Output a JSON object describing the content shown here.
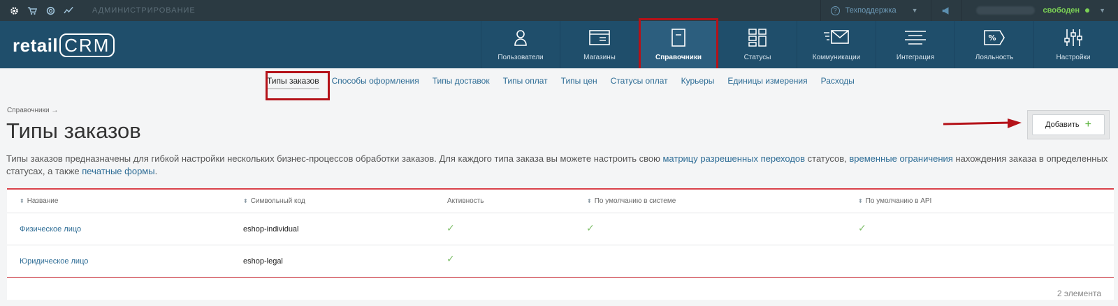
{
  "topbar": {
    "admin_label": "АДМИНИСТРИРОВАНИЕ",
    "support_label": "Техподдержка",
    "status_label": "свободен"
  },
  "header": {
    "logo_text": "retail",
    "logo_crm": "CRM",
    "nav": [
      {
        "label": "Пользователи",
        "icon": "user-icon"
      },
      {
        "label": "Магазины",
        "icon": "store-icon"
      },
      {
        "label": "Справочники",
        "icon": "reference-book-icon"
      },
      {
        "label": "Статусы",
        "icon": "statuses-icon"
      },
      {
        "label": "Коммуникации",
        "icon": "communications-icon"
      },
      {
        "label": "Интеграция",
        "icon": "integration-icon"
      },
      {
        "label": "Лояльность",
        "icon": "loyalty-icon"
      },
      {
        "label": "Настройки",
        "icon": "settings-sliders-icon"
      }
    ]
  },
  "subnav": [
    "Типы заказов",
    "Способы оформления",
    "Типы доставок",
    "Типы оплат",
    "Типы цен",
    "Статусы оплат",
    "Курьеры",
    "Единицы измерения",
    "Расходы"
  ],
  "page": {
    "breadcrumb": "Справочники →",
    "title": "Типы заказов",
    "add_button": "Добавить",
    "description": {
      "part1": "Типы заказов предназначены для гибкой настройки нескольких бизнес-процессов обработки заказов. Для каждого типа заказа вы можете настроить свою ",
      "link1": "матрицу разрешенных переходов",
      "part2": " статусов, ",
      "link2": "временные ограничения",
      "part3": " нахождения заказа в определенных статусах, а также ",
      "link3": "печатные формы",
      "part4": "."
    }
  },
  "table": {
    "columns": [
      "Название",
      "Символьный код",
      "Активность",
      "По умолчанию в системе",
      "По умолчанию в API"
    ],
    "rows": [
      {
        "name": "Физическое лицо",
        "code": "eshop-individual",
        "active": true,
        "default_system": true,
        "default_api": true
      },
      {
        "name": "Юридическое лицо",
        "code": "eshop-legal",
        "active": true,
        "default_system": false,
        "default_api": false
      }
    ],
    "count": "2 элемента"
  },
  "colors": {
    "header_bg": "#1f4e6b",
    "topbar_bg": "#2b3a42",
    "link": "#2d6c95",
    "highlight": "#b41219",
    "check": "#7fbf6a",
    "status": "#7bd155"
  }
}
